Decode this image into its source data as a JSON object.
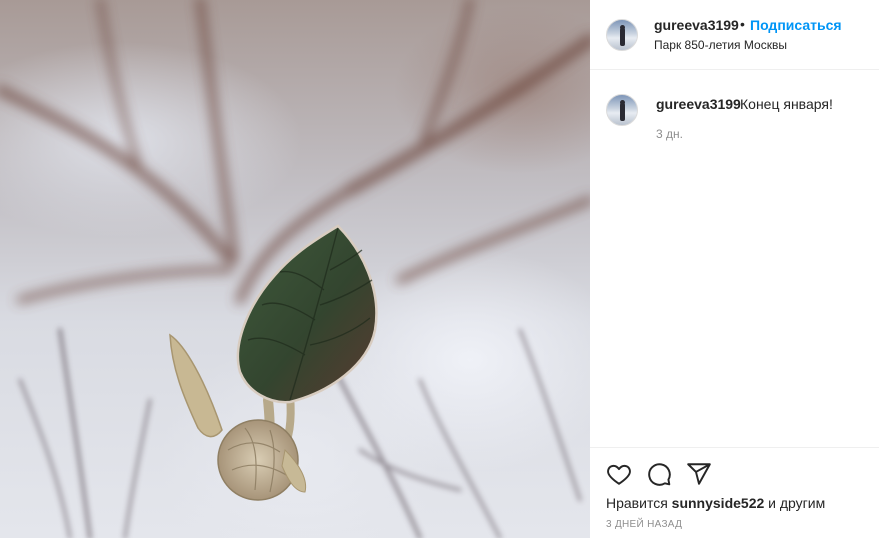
{
  "post": {
    "username": "gureeva3199",
    "separator": "•",
    "follow_label": "Подписаться",
    "location": "Парк 850-летия Москвы",
    "caption": "Конец января!",
    "caption_time": "3 дн.",
    "likes_prefix": "Нравится",
    "likes_user": "sunnyside522",
    "likes_suffix": "и другим",
    "date": "3 ДНЕЙ НАЗАД"
  },
  "icons": {
    "like": "heart-icon",
    "comment": "comment-icon",
    "share": "share-icon"
  }
}
